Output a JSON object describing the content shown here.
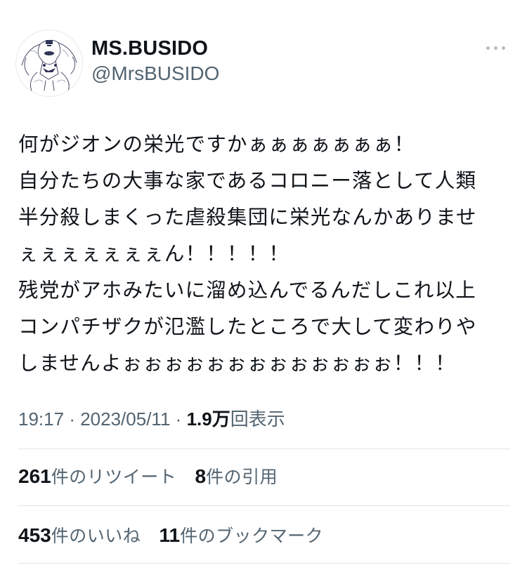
{
  "author": {
    "display_name": "MS.BUSIDO",
    "handle": "@MrsBUSIDO"
  },
  "tweet": {
    "lines": [
      "何がジオンの栄光ですかぁぁぁぁぁぁぁ！",
      "自分たちの大事な家であるコロニー落として人類",
      "半分殺しまくった虐殺集団に栄光なんかありませ",
      "ぇぇぇぇぇぇぇん！！！！！",
      "残党がアホみたいに溜め込んでるんだしこれ以上",
      "コンパチザクが氾濫したところで大して変わりや",
      "しませんよぉぉぉぉぉぉぉぉぉぉぉぉぉ！！！"
    ]
  },
  "meta": {
    "time": "19:17",
    "separator": "·",
    "date": "2023/05/11",
    "views_count": "1.9万",
    "views_label": "回表示"
  },
  "stats": {
    "retweets_count": "261",
    "retweets_label": "件のリツイート",
    "quotes_count": "8",
    "quotes_label": "件の引用",
    "likes_count": "453",
    "likes_label": "件のいいね",
    "bookmarks_count": "11",
    "bookmarks_label": "件のブックマーク"
  },
  "icons": {
    "more": "more-horizontal-icon",
    "avatar": "avatar-illustration"
  },
  "colors": {
    "text_primary": "#0f1419",
    "text_secondary": "#536471",
    "divider": "#e1e6ea"
  }
}
